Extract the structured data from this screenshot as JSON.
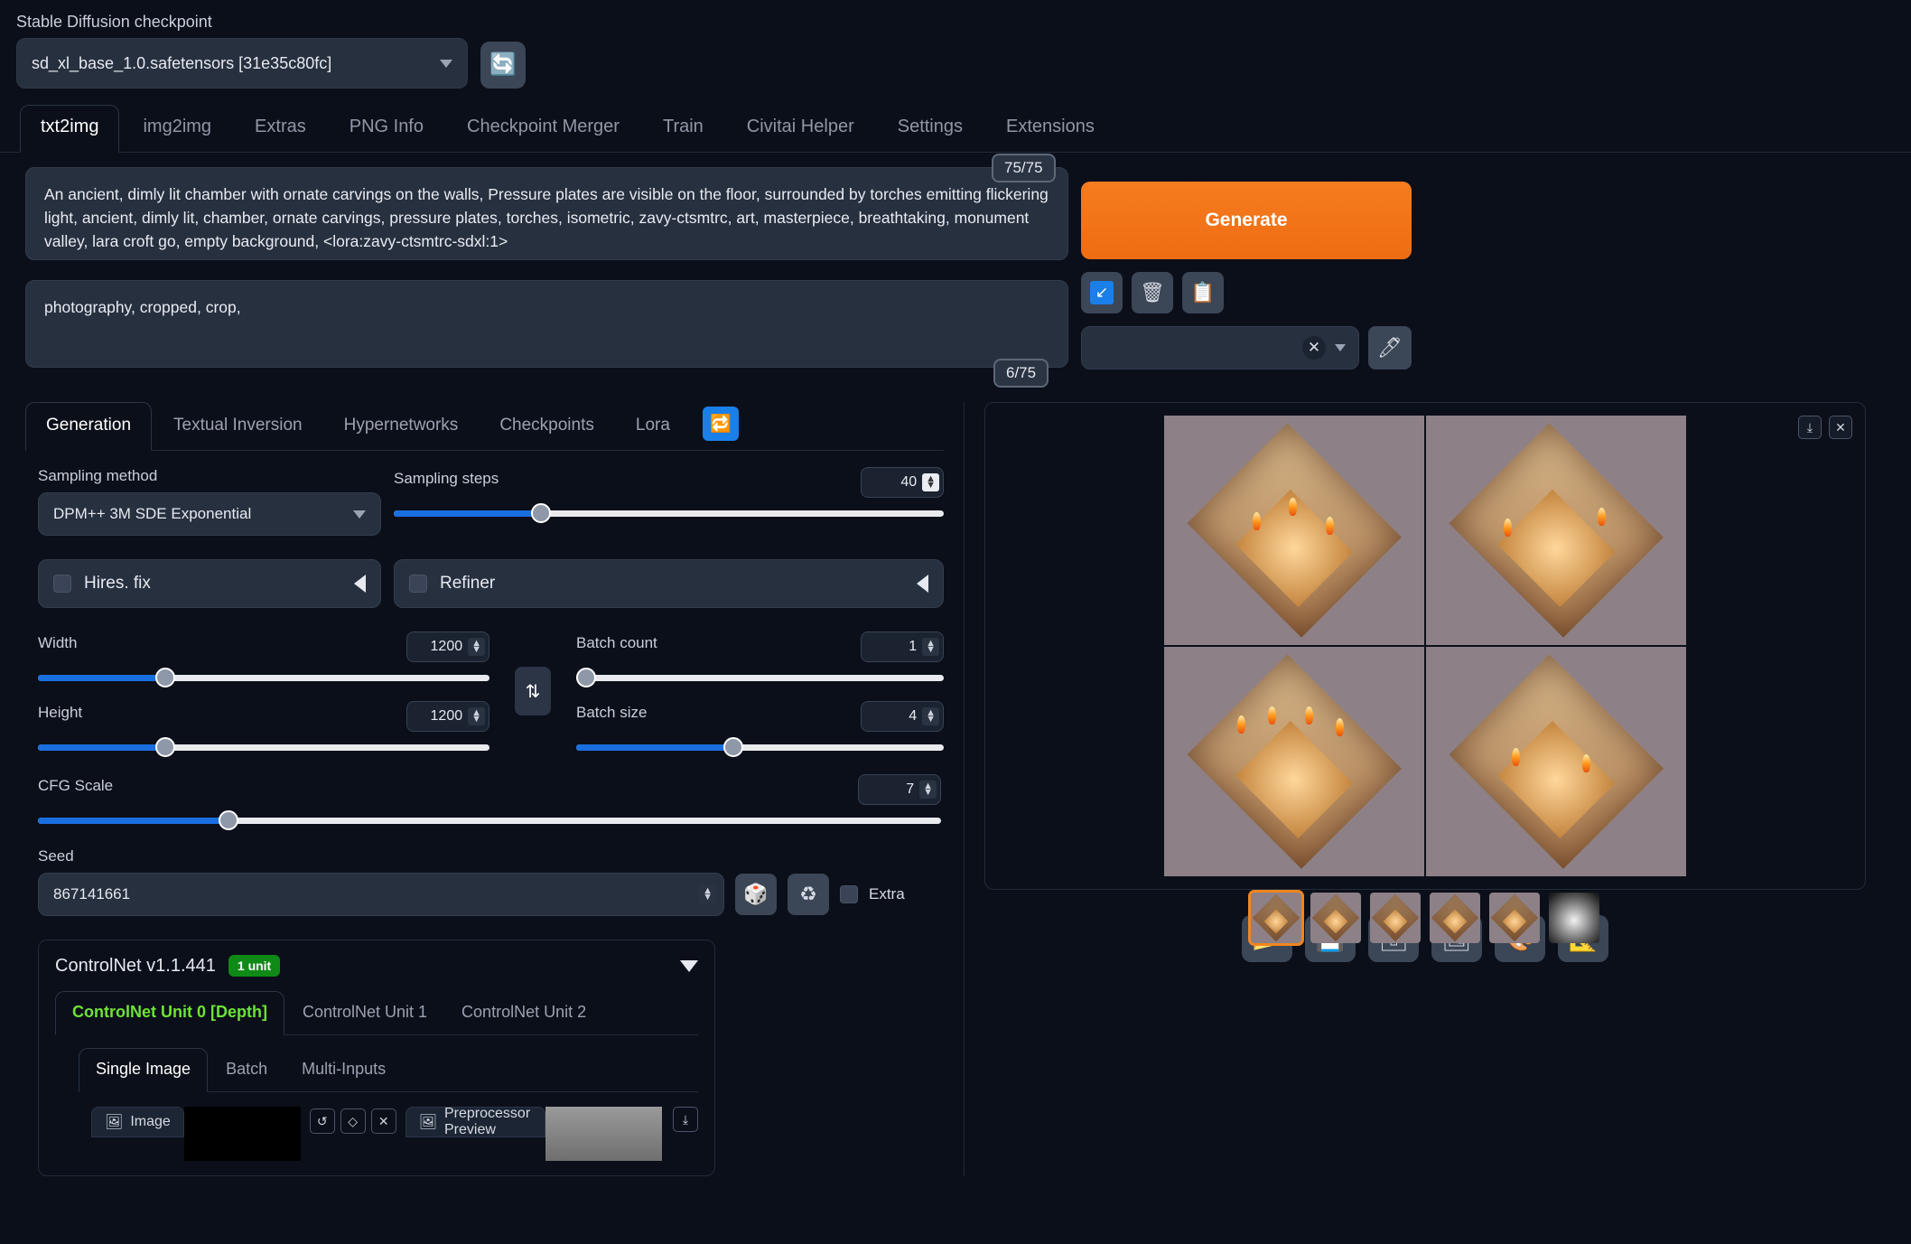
{
  "checkpoint": {
    "label": "Stable Diffusion checkpoint",
    "value": "sd_xl_base_1.0.safetensors [31e35c80fc]",
    "refresh_icon": "🔄"
  },
  "main_tabs": [
    {
      "label": "txt2img",
      "active": true
    },
    {
      "label": "img2img",
      "active": false
    },
    {
      "label": "Extras",
      "active": false
    },
    {
      "label": "PNG Info",
      "active": false
    },
    {
      "label": "Checkpoint Merger",
      "active": false
    },
    {
      "label": "Train",
      "active": false
    },
    {
      "label": "Civitai Helper",
      "active": false
    },
    {
      "label": "Settings",
      "active": false
    },
    {
      "label": "Extensions",
      "active": false
    }
  ],
  "prompt": {
    "positive": "An ancient, dimly lit chamber with ornate carvings on the walls, Pressure plates are visible on the floor, surrounded by torches emitting flickering light, ancient, dimly lit, chamber, ornate carvings, pressure plates, torches, isometric, zavy-ctsmtrc, art, masterpiece, breathtaking, monument valley, lara croft go, empty background, <lora:zavy-ctsmtrc-sdxl:1>",
    "negative": "photography, cropped, crop,",
    "positive_tokens": "75/75",
    "negative_tokens": "6/75"
  },
  "generate": {
    "label": "Generate",
    "buttons": [
      {
        "name": "restore-progress",
        "icon": "↙"
      },
      {
        "name": "clear-prompt",
        "icon": "🗑"
      },
      {
        "name": "apply-style",
        "icon": "📋"
      }
    ],
    "styles_value": "",
    "clear_icon": "✕",
    "edit_icon": "🖊"
  },
  "gen_tabs": [
    {
      "label": "Generation",
      "active": true
    },
    {
      "label": "Textual Inversion",
      "active": false
    },
    {
      "label": "Hypernetworks",
      "active": false
    },
    {
      "label": "Checkpoints",
      "active": false
    },
    {
      "label": "Lora",
      "active": false
    }
  ],
  "gen_refresh_icon": "🔁",
  "settings": {
    "sampling_method_label": "Sampling method",
    "sampling_method_value": "DPM++ 3M SDE Exponential",
    "sampling_steps_label": "Sampling steps",
    "sampling_steps_value": "40",
    "hires_fix_label": "Hires. fix",
    "refiner_label": "Refiner",
    "width_label": "Width",
    "width_value": "1200",
    "height_label": "Height",
    "height_value": "1200",
    "batch_count_label": "Batch count",
    "batch_count_value": "1",
    "batch_size_label": "Batch size",
    "batch_size_value": "4",
    "cfg_label": "CFG Scale",
    "cfg_value": "7",
    "seed_label": "Seed",
    "seed_value": "867141661",
    "extra_label": "Extra",
    "swap_icon": "⇅",
    "dice_icon": "🎲",
    "recycle_icon": "♻"
  },
  "controlnet": {
    "title": "ControlNet v1.1.441",
    "unit_badge": "1 unit",
    "unit_tabs": [
      {
        "label": "ControlNet Unit 0 [Depth]",
        "active": true
      },
      {
        "label": "ControlNet Unit 1",
        "active": false
      },
      {
        "label": "ControlNet Unit 2",
        "active": false
      }
    ],
    "input_tabs": [
      {
        "label": "Single Image",
        "active": true
      },
      {
        "label": "Batch",
        "active": false
      },
      {
        "label": "Multi-Inputs",
        "active": false
      }
    ],
    "image_chip": "Image",
    "preview_chip": "Preprocessor Preview",
    "tools": [
      "↺",
      "◇",
      "✕"
    ],
    "download_icon": "⤓"
  },
  "gallery": {
    "tools": [
      {
        "name": "download-image",
        "icon": "⤓"
      },
      {
        "name": "close-gallery",
        "icon": "✕"
      }
    ],
    "selected_thumb_index": 0,
    "thumbs": [
      "grid",
      "room-1",
      "room-2",
      "room-3",
      "room-4",
      "depth-map"
    ],
    "bottom_tools": [
      {
        "name": "open-folder",
        "icon": "📂"
      },
      {
        "name": "save-image",
        "icon": "💾"
      },
      {
        "name": "save-zip",
        "icon": "🗃"
      },
      {
        "name": "send-to-img2img",
        "icon": "🖼"
      },
      {
        "name": "send-to-inpaint",
        "icon": "🎨"
      },
      {
        "name": "send-to-extras",
        "icon": "📐"
      }
    ]
  },
  "colors": {
    "accent_orange": "#f0861f",
    "slider_blue": "#1a6fe0",
    "badge_green": "#0f8a16",
    "cn_active_green": "#6de335"
  }
}
